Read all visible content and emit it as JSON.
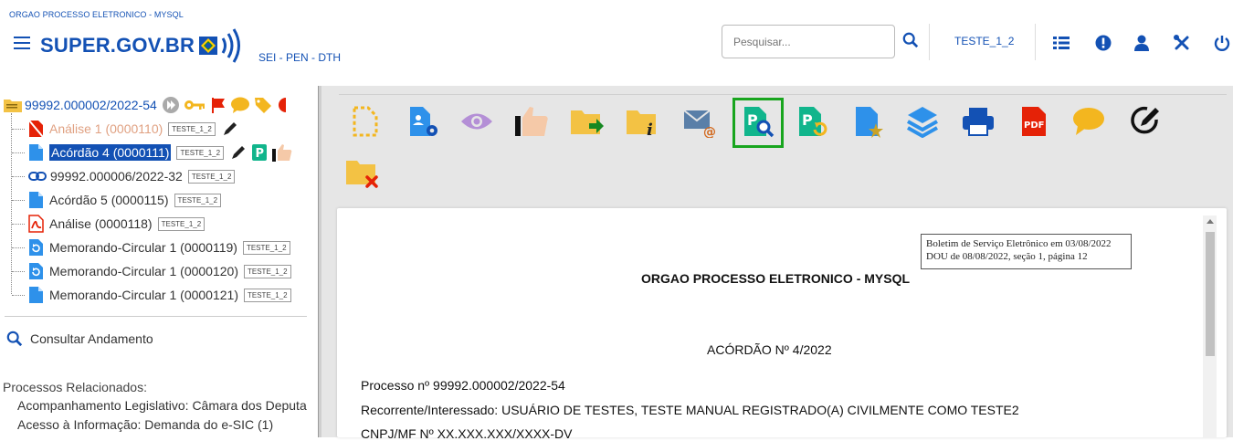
{
  "header": {
    "org_name": "ORGAO PROCESSO ELETRONICO - MYSQL",
    "logo_main": "SUPER",
    "logo_dot": ".",
    "logo_domain": "GOV.BR",
    "system_name": "SEI - PEN - DTH",
    "search_placeholder": "Pesquisar...",
    "user_unit": "TESTE_1_2",
    "accent_color": "#1351b4"
  },
  "tree": {
    "root": "99992.000002/2022-54",
    "items": [
      {
        "label": "Análise 1 (0000110)",
        "tag": "TESTE_1_2"
      },
      {
        "label": "Acórdão 4 (0000111)",
        "tag": "TESTE_1_2"
      },
      {
        "label": "99992.000006/2022-32",
        "tag": "TESTE_1_2"
      },
      {
        "label": "Acórdão 5 (0000115)",
        "tag": "TESTE_1_2"
      },
      {
        "label": "Análise (0000118)",
        "tag": "TESTE_1_2"
      },
      {
        "label": "Memorando-Circular 1 (0000119)",
        "tag": "TESTE_1_2"
      },
      {
        "label": "Memorando-Circular 1 (0000120)",
        "tag": "TESTE_1_2"
      },
      {
        "label": "Memorando-Circular 1 (0000121)",
        "tag": "TESTE_1_2"
      }
    ],
    "consult_label": "Consultar Andamento",
    "related_title": "Processos Relacionados:",
    "related": [
      "Acompanhamento Legislativo: Câmara dos Deputa",
      "Acesso à Informação: Demanda do e-SIC (1)"
    ]
  },
  "document": {
    "stamp_line1": "Boletim de Serviço Eletrônico em 03/08/2022",
    "stamp_line2": "DOU de 08/08/2022, seção 1, página 12",
    "org": "ORGAO PROCESSO ELETRONICO - MYSQL",
    "title": "ACÓRDÃO Nº 4/2022",
    "process": "Processo nº 99992.000002/2022-54",
    "interested": "Recorrente/Interessado: USUÁRIO DE TESTES, TESTE MANUAL REGISTRADO(A) CIVILMENTE COMO TESTE2",
    "cnpj": "CNPJ/MF Nº XX.XXX.XXX/XXXX-DV"
  },
  "toolbar_icons": [
    "new-document-icon",
    "document-settings-icon",
    "view-icon",
    "approve-icon",
    "move-to-folder-icon",
    "folder-info-icon",
    "send-email-icon",
    "publication-search-icon",
    "publication-refresh-icon",
    "document-favorite-icon",
    "layers-icon",
    "print-icon",
    "pdf-icon",
    "comment-icon",
    "sign-icon",
    "delete-folder-icon"
  ]
}
